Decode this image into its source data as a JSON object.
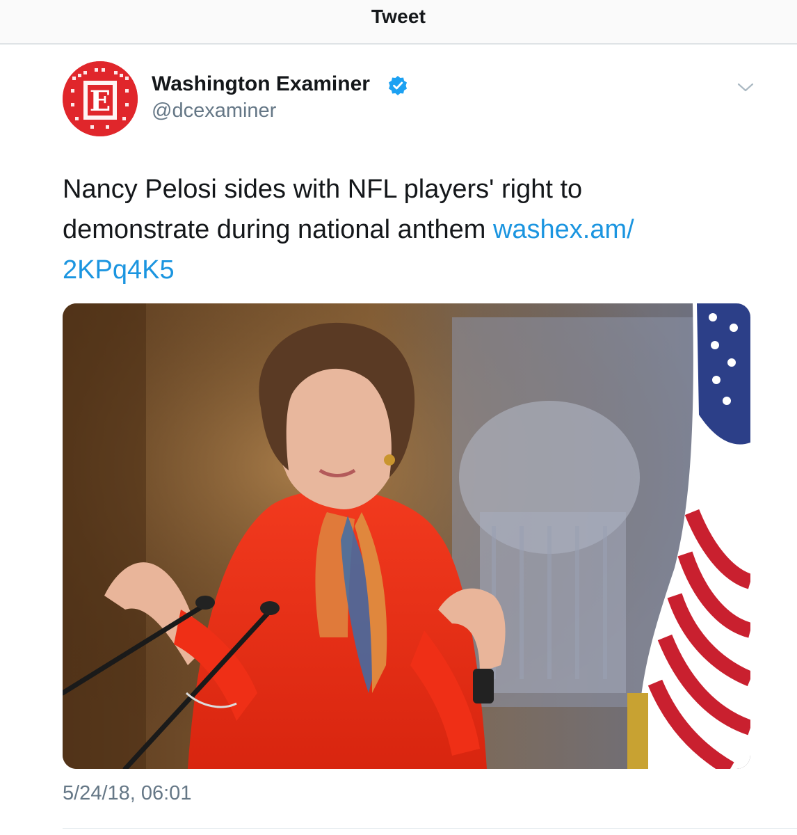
{
  "header": {
    "title": "Tweet"
  },
  "author": {
    "name": "Washington Examiner",
    "handle": "@dcexaminer",
    "verified": true,
    "avatar_icon": "washington-examiner-logo",
    "avatar_color": "#e0262b"
  },
  "tweet": {
    "text": "Nancy Pelosi sides with NFL players' right to demonstrate during national anthem ",
    "link_text": "washex.am/ 2KPq4K5",
    "link_color": "#1b95e0",
    "timestamp": "5/24/18, 06:01"
  },
  "menu": {
    "icon": "chevron-down-icon"
  },
  "colors": {
    "text": "#14171a",
    "secondary_text": "#657786",
    "verified_badge": "#1da1f2"
  }
}
